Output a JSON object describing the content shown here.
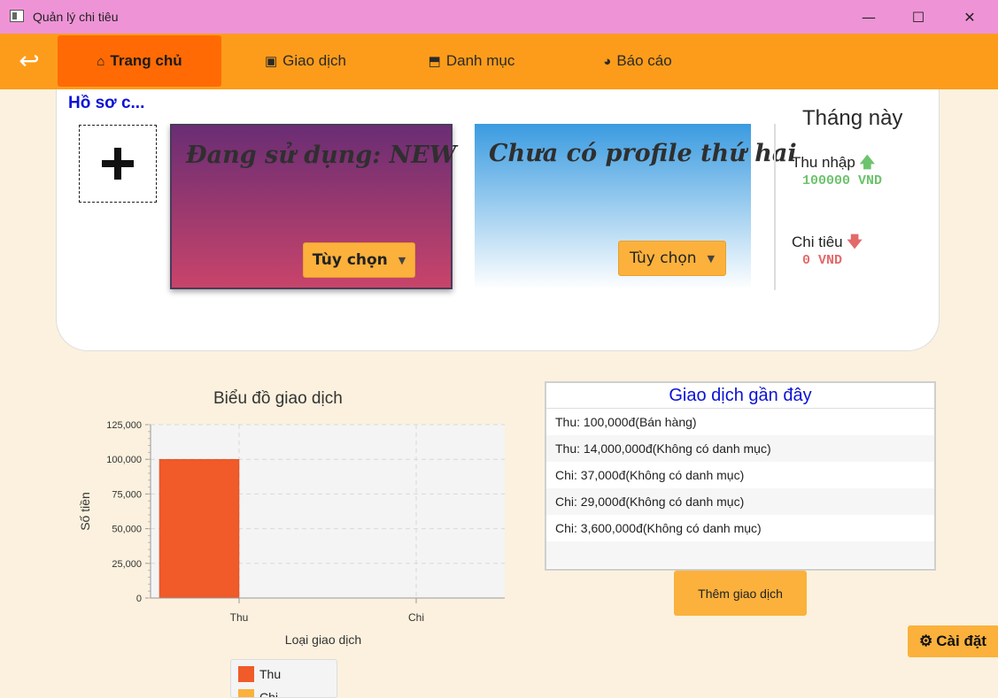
{
  "window": {
    "title": "Quản lý chi tiêu",
    "minimize": "—",
    "maximize": "☐",
    "close": "✕"
  },
  "nav": {
    "back_icon": "↩",
    "tabs": [
      {
        "label": "Trang chủ",
        "icon": "home-icon",
        "glyph": "⌂"
      },
      {
        "label": "Giao dịch",
        "icon": "money-icon",
        "glyph": "▣"
      },
      {
        "label": "Danh mục",
        "icon": "bookmark-icon",
        "glyph": "⬒"
      },
      {
        "label": "Báo cáo",
        "icon": "pie-chart-icon",
        "glyph": "◕"
      }
    ]
  },
  "profiles": {
    "section_title": "Hồ sơ c...",
    "add_glyph": "+",
    "card1": {
      "title": "Đang sử dụng: NEW",
      "option_label": "Tùy chọn"
    },
    "card2": {
      "title": "Chưa có profile thứ hai",
      "option_label": "Tùy chọn"
    }
  },
  "month": {
    "title": "Tháng này",
    "income_label": "Thu nhập",
    "income_value": "100000 VND",
    "income_arrow": "🡅",
    "expense_label": "Chi tiêu",
    "expense_value": "0 VND",
    "expense_arrow": "🡇"
  },
  "chart_data": {
    "type": "bar",
    "title": "Biểu đồ giao dịch",
    "xlabel": "Loại giao dịch",
    "ylabel": "Số tiền",
    "categories": [
      "Thu",
      "Chi"
    ],
    "series": [
      {
        "name": "Thu",
        "values": [
          100000,
          0
        ],
        "color": "#f15a29"
      },
      {
        "name": "Chi",
        "values": [
          0,
          0
        ],
        "color": "#fbb13c"
      }
    ],
    "ylim": [
      0,
      125000
    ],
    "yticks": [
      0,
      25000,
      50000,
      75000,
      100000,
      125000
    ],
    "ytick_labels": [
      "0",
      "25,000",
      "50,000",
      "75,000",
      "100,000",
      "125,000"
    ],
    "grid": true,
    "legend_position": "bottom"
  },
  "recent": {
    "title": "Giao dịch gần đây",
    "rows": [
      "Thu: 100,000đ(Bán hàng)",
      "Thu: 14,000,000đ(Không có danh mục)",
      "Chi: 37,000đ(Không có danh mục)",
      "Chi: 29,000đ(Không có danh mục)",
      "Chi: 3,600,000đ(Không có danh mục)"
    ]
  },
  "add_transaction_label": "Thêm giao dịch",
  "settings_label": "Cài đặt",
  "colors": {
    "nav": "#fd9c1a",
    "nav_active": "#ff6a05",
    "titlebar": "#ee94d6",
    "button": "#fbb13c",
    "accent_text": "#0b12d6"
  }
}
